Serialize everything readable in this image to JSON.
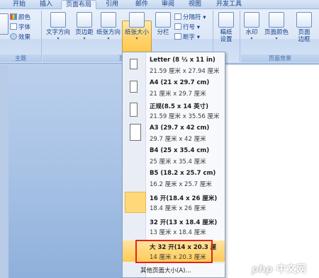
{
  "tabs": [
    "开始",
    "插入",
    "页面布局",
    "引用",
    "邮件",
    "审阅",
    "视图",
    "开发工具"
  ],
  "active_tab": "页面布局",
  "ribbon": {
    "theme_group": {
      "label": "主题",
      "colors": "颜色",
      "fonts": "字体",
      "effects": "效果"
    },
    "page_setup": {
      "label": "页面设",
      "text_direction": "文字方向",
      "margins": "页边距",
      "orientation": "纸张方向",
      "size": "纸张大小",
      "columns": "分栏",
      "breaks": "分隔符",
      "line_numbers": "行号",
      "hyphenation": "断字"
    },
    "draft_settings": {
      "line1": "稿纸",
      "line2": "设置"
    },
    "page_background": {
      "label": "页面背景",
      "watermark": "水印",
      "page_color": "页面颜色",
      "page_borders_1": "页面",
      "page_borders_2": "边框"
    }
  },
  "size_menu": {
    "items": [
      {
        "name": "Letter (8 ½ x 11 in)",
        "dims": "21.59 厘米 x 27.94 厘米"
      },
      {
        "name": "A4 (21 x 29.7 cm)",
        "dims": "21 厘米 x 29.7 厘米"
      },
      {
        "name": "正规(8.5 x 14 英寸)",
        "dims": "21.59 厘米 x 35.56 厘米"
      },
      {
        "name": "A3 (29.7 x 42 cm)",
        "dims": "29.7 厘米 x 42 厘米"
      },
      {
        "name": "B4 (25 x 35.4 cm)",
        "dims": "25 厘米 x 35.4 厘米"
      },
      {
        "name": "B5 (18.2 x 25.7 cm)",
        "dims": "16.2 厘米 x 25.7 厘米"
      },
      {
        "name": "16 开(18.4 x 26 厘米)",
        "dims": "18.4 厘米 x 26 厘米"
      },
      {
        "name": "32 开(13 x 18.4 厘米)",
        "dims": "13 厘米 x 18.4 厘米"
      },
      {
        "name": "大 32 开(14 x 20.3 厘",
        "dims": "14 厘米 x 20.3 厘米"
      }
    ],
    "more": "其他页面大小(A)..."
  },
  "watermark": {
    "php": "php",
    "cn": "中文网"
  }
}
